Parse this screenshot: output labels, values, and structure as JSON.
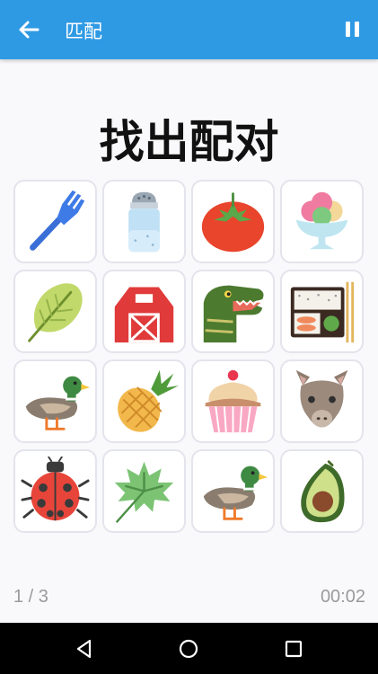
{
  "app_bar": {
    "title": "匹配",
    "back_icon": "arrow-left-icon",
    "pause_icon": "pause-icon",
    "color": "#2f9ae4"
  },
  "heading": "找出配对",
  "tiles": [
    {
      "icon": "fork-icon"
    },
    {
      "icon": "salt-shaker-icon"
    },
    {
      "icon": "tomato-icon"
    },
    {
      "icon": "ice-cream-icon"
    },
    {
      "icon": "leaf-icon"
    },
    {
      "icon": "barn-icon"
    },
    {
      "icon": "t-rex-icon"
    },
    {
      "icon": "bento-box-icon"
    },
    {
      "icon": "duck-icon"
    },
    {
      "icon": "pineapple-icon"
    },
    {
      "icon": "cupcake-icon"
    },
    {
      "icon": "llama-icon"
    },
    {
      "icon": "ladybug-icon"
    },
    {
      "icon": "maple-leaf-icon"
    },
    {
      "icon": "duck-icon"
    },
    {
      "icon": "avocado-icon"
    }
  ],
  "footer": {
    "progress": "1 / 3",
    "timer": "00:02"
  },
  "navigation_bar": {
    "back_icon": "nav-back-icon",
    "home_icon": "nav-home-icon",
    "recents_icon": "nav-recents-icon"
  }
}
